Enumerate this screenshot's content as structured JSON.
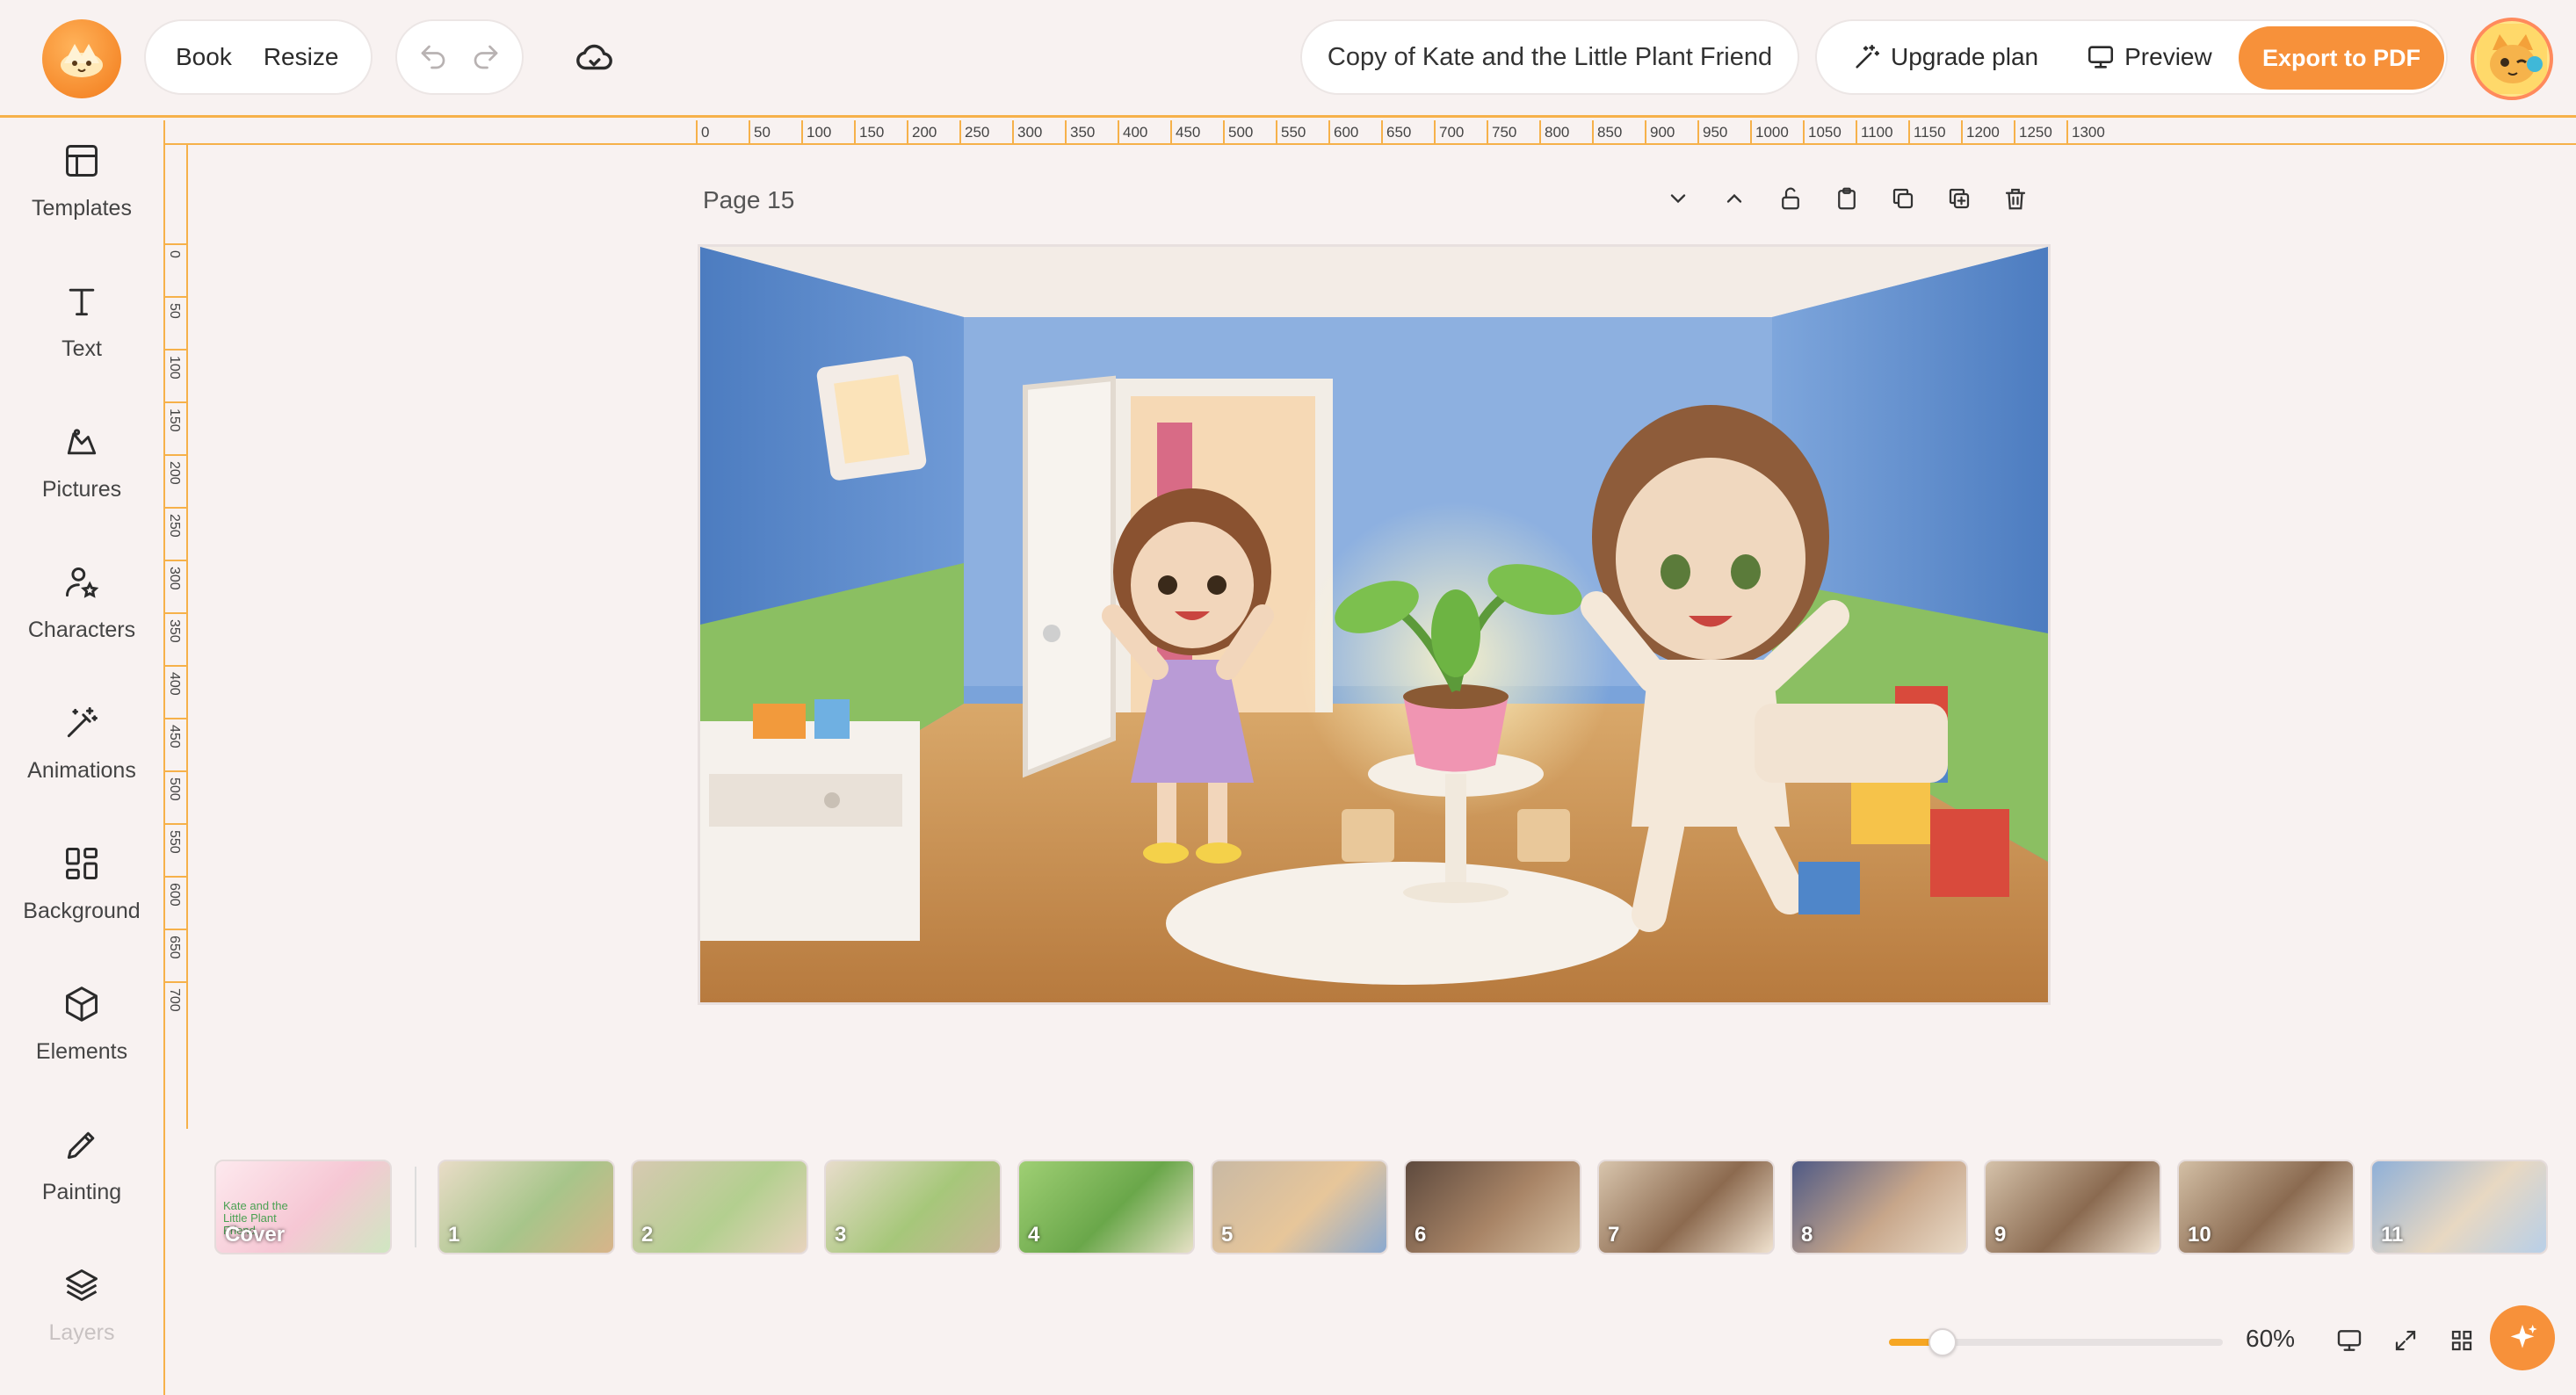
{
  "topbar": {
    "book_label": "Book",
    "resize_label": "Resize",
    "doc_title": "Copy of Kate and the Little Plant Friend",
    "upgrade_label": "Upgrade plan",
    "preview_label": "Preview",
    "export_label": "Export to PDF",
    "accent_color": "#f7913a"
  },
  "sidebar": {
    "items": [
      {
        "label": "Templates",
        "icon": "templates-icon"
      },
      {
        "label": "Text",
        "icon": "text-icon"
      },
      {
        "label": "Pictures",
        "icon": "pictures-icon"
      },
      {
        "label": "Characters",
        "icon": "characters-icon"
      },
      {
        "label": "Animations",
        "icon": "animations-icon"
      },
      {
        "label": "Background",
        "icon": "background-icon"
      },
      {
        "label": "Elements",
        "icon": "elements-icon"
      },
      {
        "label": "Painting",
        "icon": "painting-icon"
      },
      {
        "label": "Layers",
        "icon": "layers-icon"
      }
    ]
  },
  "ruler": {
    "h_ticks": [
      "0",
      "50",
      "100",
      "150",
      "200",
      "250",
      "300",
      "350",
      "400",
      "450",
      "500",
      "550",
      "600",
      "650",
      "700",
      "750",
      "800",
      "850",
      "900",
      "950",
      "1000",
      "1050",
      "1100",
      "1150",
      "1200",
      "1250",
      "1300"
    ],
    "v_ticks": [
      "0",
      "50",
      "100",
      "150",
      "200",
      "250",
      "300",
      "350",
      "400",
      "450",
      "500",
      "550",
      "600",
      "650",
      "700"
    ]
  },
  "page": {
    "label": "Page 15"
  },
  "thumbnails": [
    {
      "label": "Cover",
      "title": "Kate and the Little Plant Friend"
    },
    {
      "label": "1"
    },
    {
      "label": "2"
    },
    {
      "label": "3"
    },
    {
      "label": "4"
    },
    {
      "label": "5"
    },
    {
      "label": "6"
    },
    {
      "label": "7"
    },
    {
      "label": "8"
    },
    {
      "label": "9"
    },
    {
      "label": "10"
    },
    {
      "label": "11"
    }
  ],
  "zoom": {
    "value_label": "60%",
    "level": 0.16
  }
}
